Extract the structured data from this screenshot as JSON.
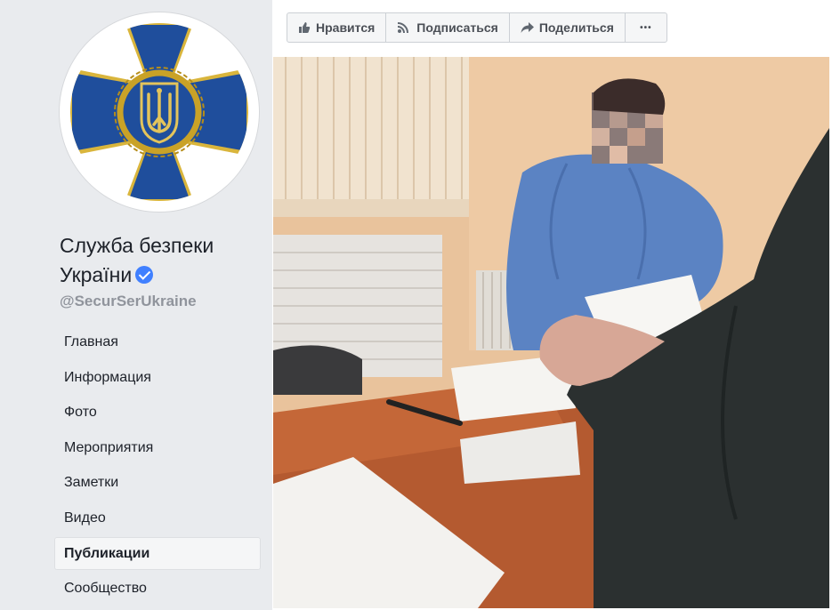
{
  "page": {
    "name_line1": "Служба безпеки",
    "name_line2": "України",
    "username": "@SecurSerUkraine"
  },
  "nav": {
    "items": [
      {
        "label": "Главная"
      },
      {
        "label": "Информация"
      },
      {
        "label": "Фото"
      },
      {
        "label": "Мероприятия"
      },
      {
        "label": "Заметки"
      },
      {
        "label": "Видео"
      },
      {
        "label": "Публикации",
        "active": true
      },
      {
        "label": "Сообщество"
      }
    ]
  },
  "actions": {
    "like_label": "Нравится",
    "follow_label": "Подписаться",
    "share_label": "Поделиться",
    "more_label": "•••"
  },
  "icons": {
    "like": "thumbs-up-icon",
    "follow": "rss-icon",
    "share": "share-arrow-icon",
    "verified": "verified-check-icon"
  },
  "colors": {
    "sidebar_bg": "#e9ebee",
    "verified": "#4080ff",
    "emblem_blue": "#1f4e9c",
    "emblem_gold": "#c9a227"
  }
}
